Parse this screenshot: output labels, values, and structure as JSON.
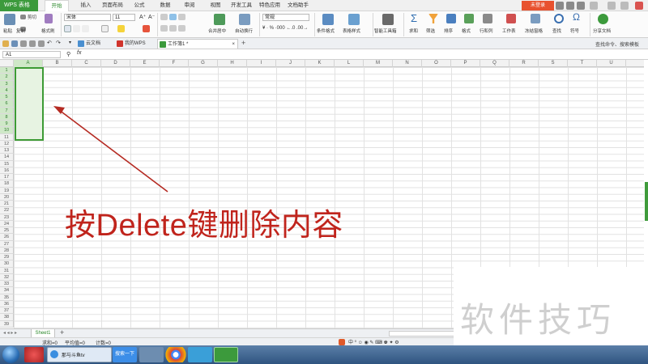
{
  "app": {
    "name": "WPS 表格",
    "login_label": "未登录"
  },
  "menu_tabs": [
    {
      "label": "开始",
      "active": true
    },
    {
      "label": "插入"
    },
    {
      "label": "页面布局"
    },
    {
      "label": "公式"
    },
    {
      "label": "数据"
    },
    {
      "label": "审阅"
    },
    {
      "label": "视图"
    },
    {
      "label": "开发工具"
    },
    {
      "label": "特色应用"
    },
    {
      "label": "文档助手"
    }
  ],
  "ribbon": {
    "paste": "粘贴",
    "cut": "剪切",
    "copy": "复制",
    "format_painter": "格式刷",
    "font_name": "宋体",
    "font_size": "11",
    "merge_center": "合并居中",
    "wrap_text": "自动换行",
    "number_format": "常规",
    "conditional_format": "条件格式",
    "table_style": "表格样式",
    "smart_toolbox": "智能工具箱",
    "sum": "求和",
    "filter": "筛选",
    "sort": "排序",
    "format": "格式",
    "row_col": "行和列",
    "worksheet": "工作表",
    "freeze_panes": "冻结窗格",
    "find": "查找",
    "symbol": "符号",
    "share": "分享文档"
  },
  "doc_tabs": [
    {
      "label": "云文档"
    },
    {
      "label": "我的WPS"
    },
    {
      "label": "工作簿1 *",
      "active": true
    }
  ],
  "search_hint": "查找命令、搜索模板",
  "formula_bar": {
    "cell_ref": "A1",
    "fx": "fx"
  },
  "columns": [
    "A",
    "B",
    "C",
    "D",
    "E",
    "F",
    "G",
    "H",
    "I",
    "J",
    "K",
    "L",
    "M",
    "N",
    "O",
    "P",
    "Q",
    "R",
    "S",
    "T",
    "U"
  ],
  "rows": [
    "1",
    "2",
    "3",
    "4",
    "5",
    "6",
    "7",
    "8",
    "9",
    "10",
    "11",
    "12",
    "13",
    "14",
    "15",
    "16",
    "17",
    "18",
    "19",
    "20",
    "21",
    "22",
    "23",
    "24",
    "25",
    "26",
    "27",
    "28",
    "29",
    "30",
    "31",
    "32",
    "33",
    "34",
    "35",
    "36",
    "37",
    "38",
    "39"
  ],
  "annotation": "按Delete键删除内容",
  "watermark": "软件技巧",
  "sheet": {
    "name": "Sheet1",
    "add": "+"
  },
  "status": {
    "sum": "求和=0",
    "average": "平均值=0",
    "count": "计数=0"
  },
  "taskbar": {
    "ie_title": "那与斗鱼tv",
    "search_button": "搜索一下"
  },
  "colors": {
    "accent": "#3c9a3c",
    "annotation": "#c0241c",
    "selection_fill": "#e7f3e2"
  }
}
